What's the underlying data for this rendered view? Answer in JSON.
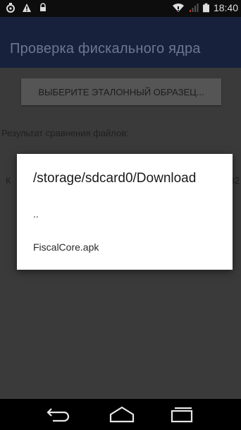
{
  "status_bar": {
    "time": "18:40",
    "icons": [
      "android-debug-icon",
      "warning-icon",
      "lock-icon",
      "wifi-icon",
      "signal-icon",
      "battery-icon"
    ]
  },
  "app_bar": {
    "title": "Проверка фискального ядра"
  },
  "main": {
    "select_button_label": "ВЫБЕРИТЕ ЭТАЛОННЫЙ ОБРАЗЕЦ...",
    "result_label": "Результат сравнения файлов:",
    "row_left": "К",
    "row_right": "32"
  },
  "dialog": {
    "title": "/storage/sdcard0/Download",
    "items": [
      "..",
      "FiscalCore.apk"
    ]
  },
  "nav_bar": {
    "icons": [
      "back-icon",
      "home-icon",
      "recent-apps-icon"
    ]
  },
  "colors": {
    "app_bar": "#17213c",
    "dialog_bg": "#ffffff",
    "dim_content": "#3a3a3a"
  }
}
